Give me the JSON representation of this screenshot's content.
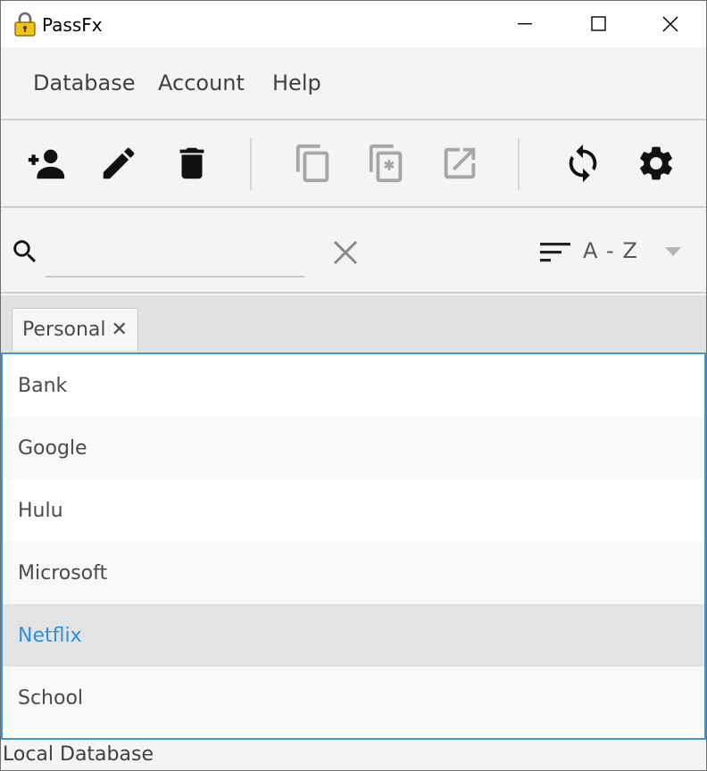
{
  "window": {
    "title": "PassFx"
  },
  "menu": {
    "items": [
      {
        "label": "Database"
      },
      {
        "label": "Account"
      },
      {
        "label": "Help"
      }
    ]
  },
  "toolbar": {
    "buttons": [
      {
        "icon": "add-person-icon",
        "enabled": true
      },
      {
        "icon": "edit-pencil-icon",
        "enabled": true
      },
      {
        "icon": "trash-icon",
        "enabled": true
      },
      {
        "icon": "copy-icon",
        "enabled": false
      },
      {
        "icon": "copy-password-icon",
        "enabled": false
      },
      {
        "icon": "open-external-icon",
        "enabled": false
      },
      {
        "icon": "sync-icon",
        "enabled": true
      },
      {
        "icon": "gear-icon",
        "enabled": true
      }
    ]
  },
  "search": {
    "value": "",
    "placeholder": "",
    "sort_label": "A - Z"
  },
  "tags": [
    {
      "label": "Personal",
      "close": "✕"
    }
  ],
  "entries": [
    {
      "label": "Bank",
      "selected": false
    },
    {
      "label": "Google",
      "selected": false
    },
    {
      "label": "Hulu",
      "selected": false
    },
    {
      "label": "Microsoft",
      "selected": false
    },
    {
      "label": "Netflix",
      "selected": true
    },
    {
      "label": "School",
      "selected": false
    }
  ],
  "status": {
    "text": "Local Database"
  },
  "colors": {
    "accent": "#2d8fe0",
    "list_border": "#3b95e5",
    "icon_active": "#111111",
    "icon_disabled": "#a6a6a6",
    "lock_body": "#f0c419"
  }
}
